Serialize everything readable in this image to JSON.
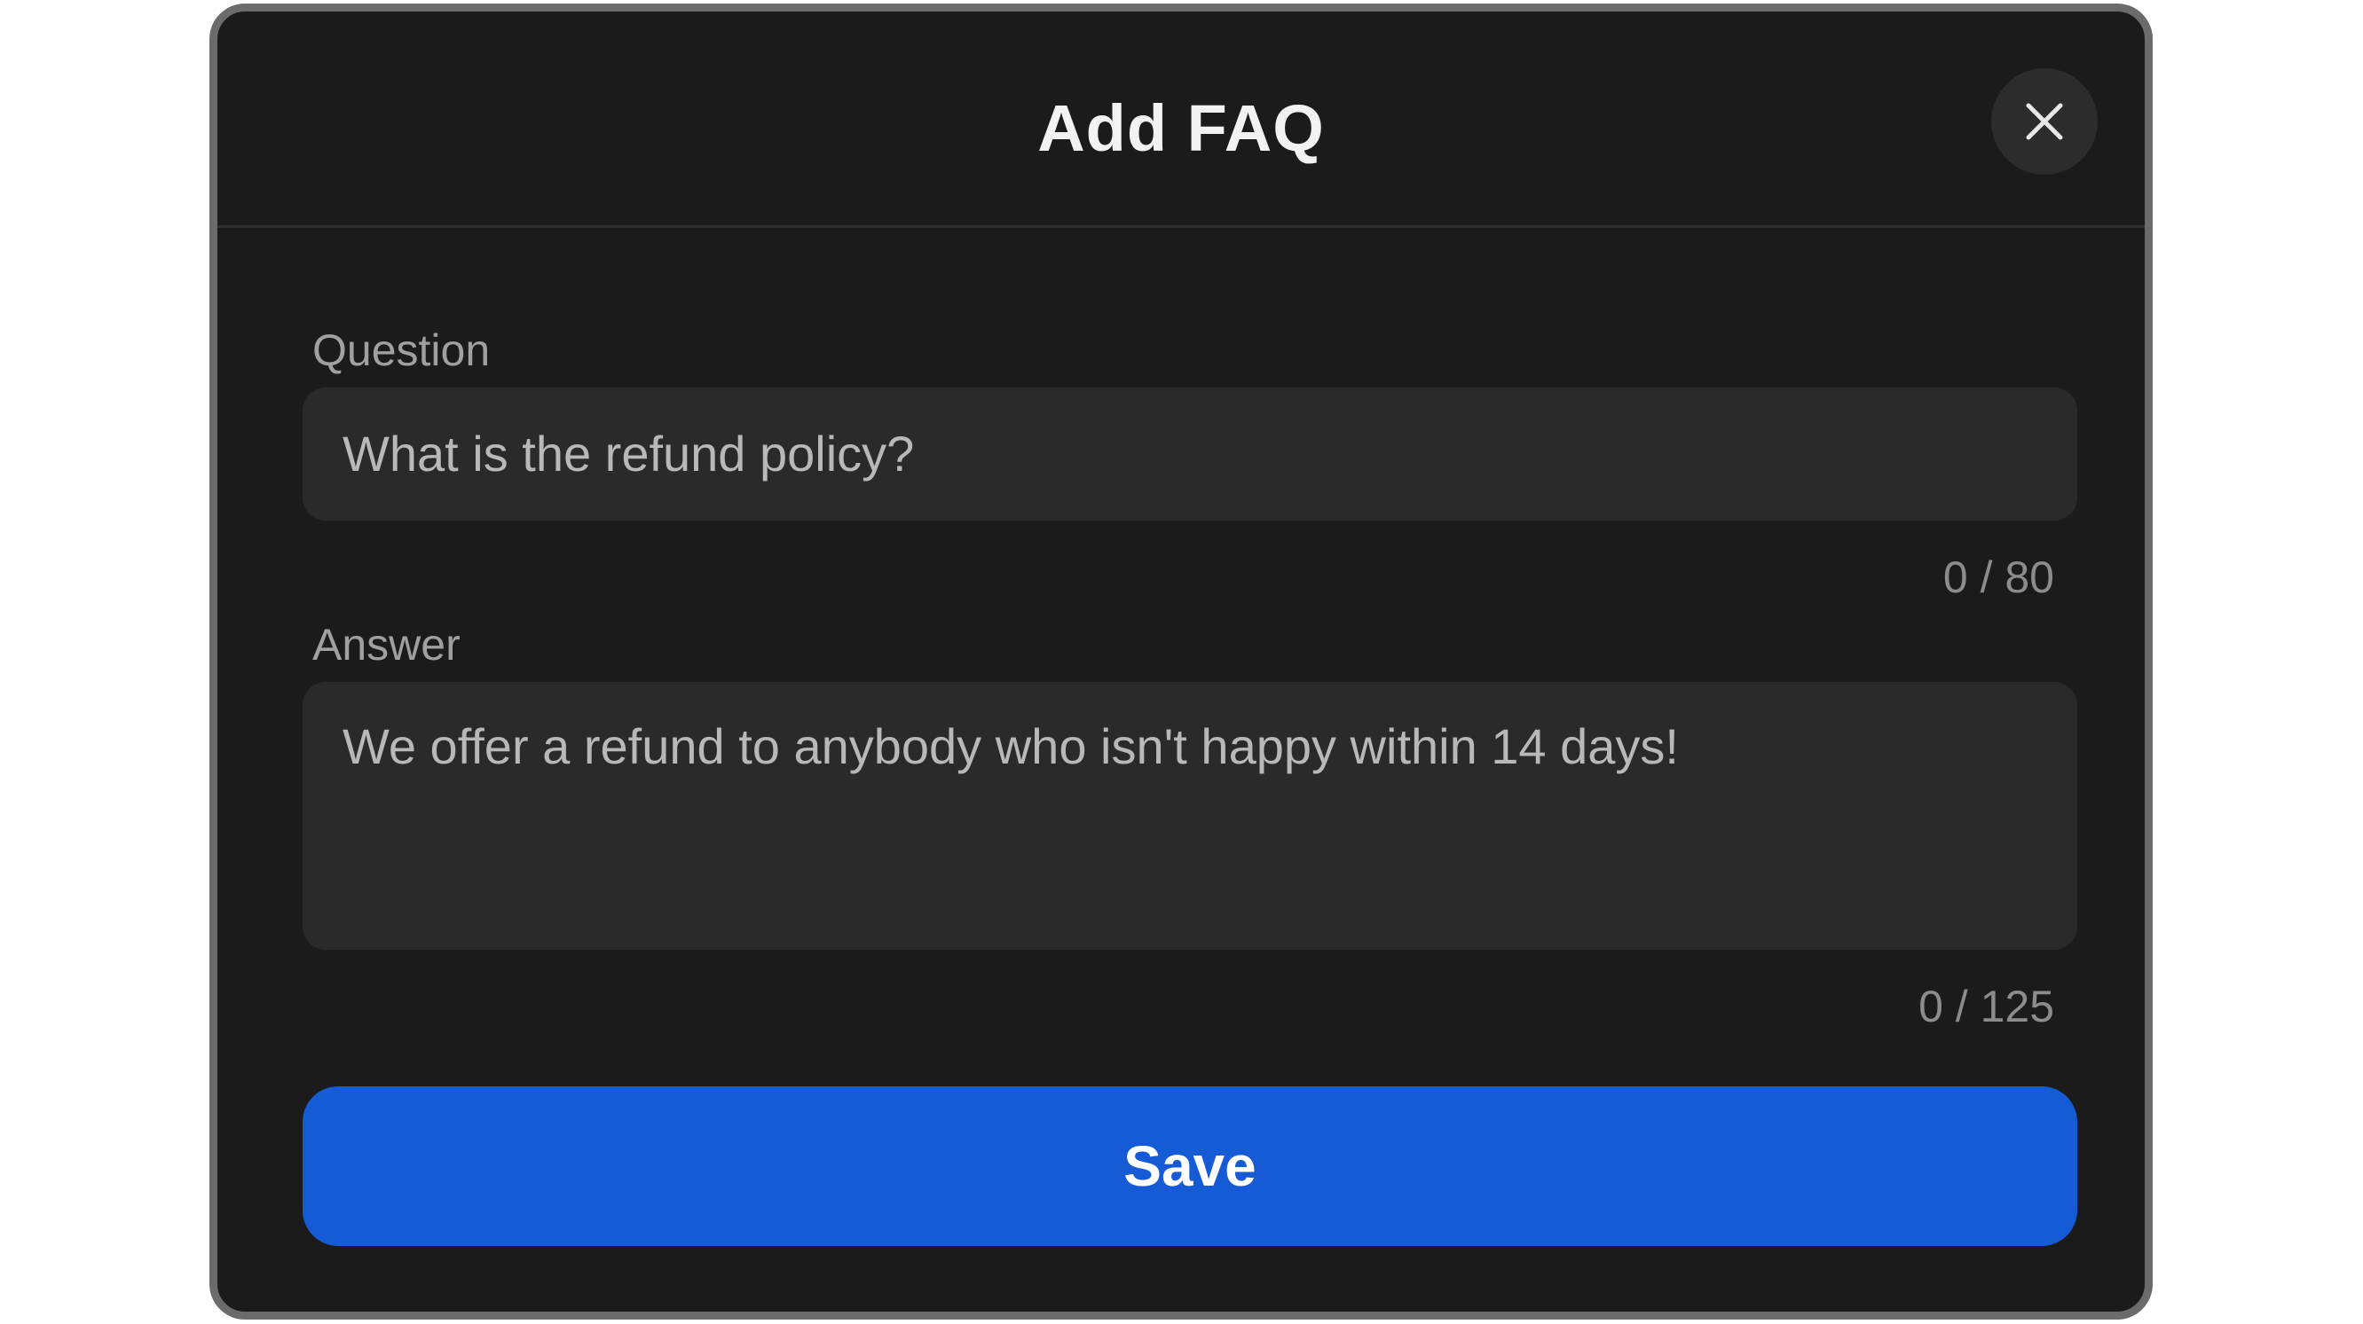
{
  "dialog": {
    "title": "Add FAQ",
    "close_icon": "close-icon"
  },
  "question": {
    "label": "Question",
    "value": "What is the refund policy?",
    "counter": "0 / 80"
  },
  "answer": {
    "label": "Answer",
    "value": "We offer a refund to anybody who isn't happy within 14 days!",
    "counter": "0 / 125"
  },
  "actions": {
    "save_label": "Save"
  },
  "colors": {
    "modal_background": "#1b1b1b",
    "modal_border": "#6b6b6b",
    "input_background": "#2a2a2a",
    "primary_button": "#155bd5"
  }
}
